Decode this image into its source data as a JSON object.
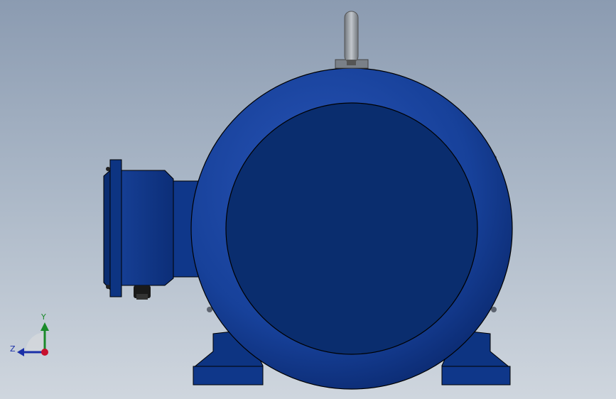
{
  "viewport": {
    "background_top": "#8b9bb1",
    "background_bottom": "#cfd6de"
  },
  "model": {
    "body_color": "#0a2d6e",
    "body_highlight": "#2a55b8",
    "edge_color": "#000000",
    "eyebolt_color": "#9aa0a6"
  },
  "triad": {
    "x_label": "Y",
    "z_label": "Z",
    "y_color": "#1a8a2a",
    "z_color": "#1a2fa8",
    "x_color": "#c8102e"
  }
}
